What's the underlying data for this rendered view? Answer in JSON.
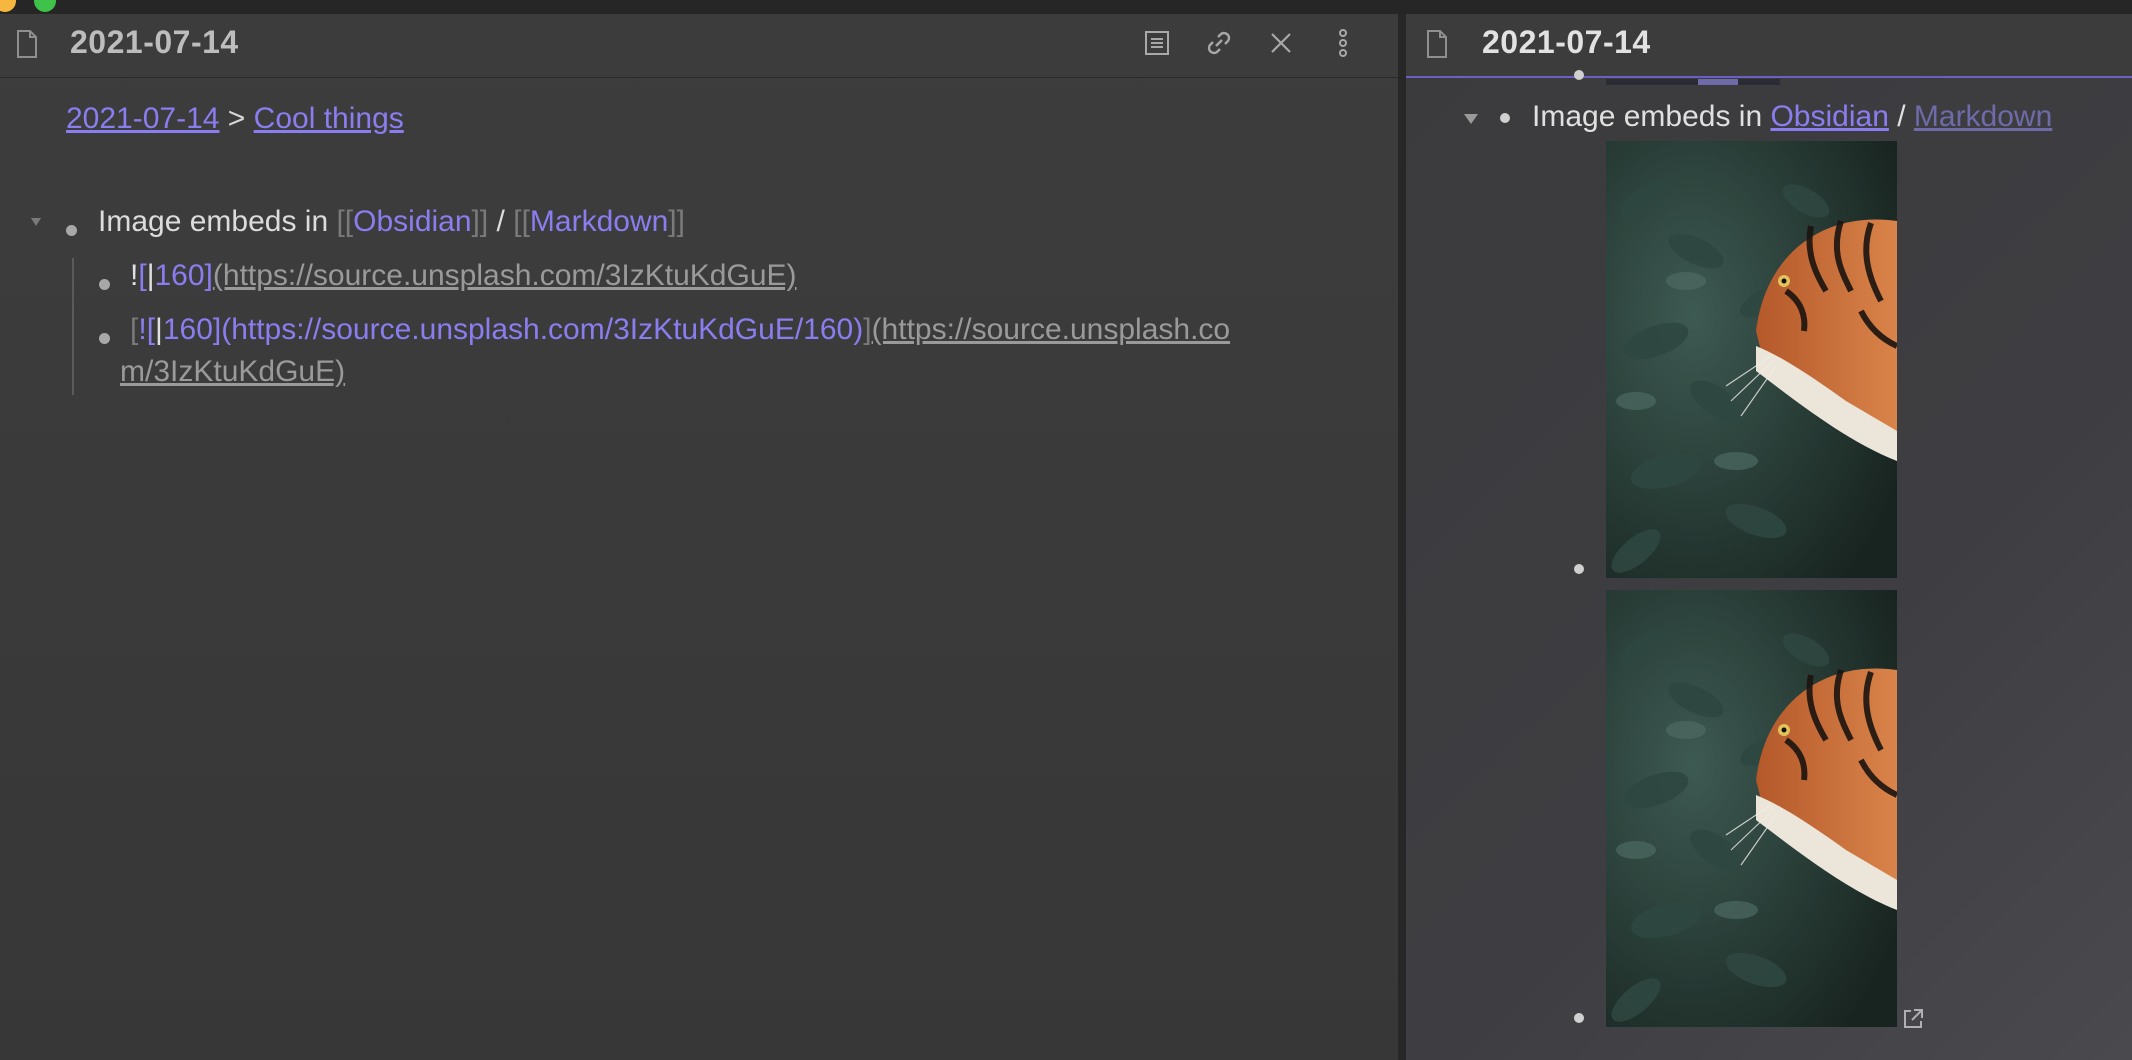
{
  "left_pane": {
    "title": "2021-07-14",
    "breadcrumb": {
      "date": "2021-07-14",
      "sep": " > ",
      "section": "Cool things"
    },
    "outline": {
      "parent": {
        "prefix": "Image embeds in ",
        "open1": "[[",
        "link1": "Obsidian",
        "close1": "]]",
        "slash": " / ",
        "open2": "[[",
        "link2": "Markdown",
        "close2": "]]"
      },
      "child1": {
        "bang": "!",
        "lb": "[",
        "cursor": "|",
        "alt": "160",
        "rb": "]",
        "url": "(https://source.unsplash.com/3IzKtuKdGuE)"
      },
      "child2": {
        "lb": "[",
        "bang": "!",
        "lb2": "[",
        "cursor": "|",
        "inner": "160](https://source.unsplash.com/3IzKtuKdGuE/160)",
        "rb": "]",
        "url_a": "(https://source.unsplash.co",
        "url_b": "m/3IzKtuKdGuE)"
      }
    }
  },
  "right_pane": {
    "title": "2021-07-14",
    "outline": {
      "prefix": "Image embeds in ",
      "link1": "Obsidian",
      "slash": " / ",
      "link2": "Markdown"
    }
  },
  "icons": {
    "file": "file-icon",
    "reading": "reading-view-icon",
    "link": "link-icon",
    "close": "close-icon",
    "more": "more-vertical-icon",
    "external": "external-link-icon",
    "collapse": "collapse-triangle-icon"
  },
  "colors": {
    "accent": "#8a7df0",
    "text": "#dcdcdc",
    "muted": "#7a7a7a",
    "bg": "#3a3a3b"
  }
}
